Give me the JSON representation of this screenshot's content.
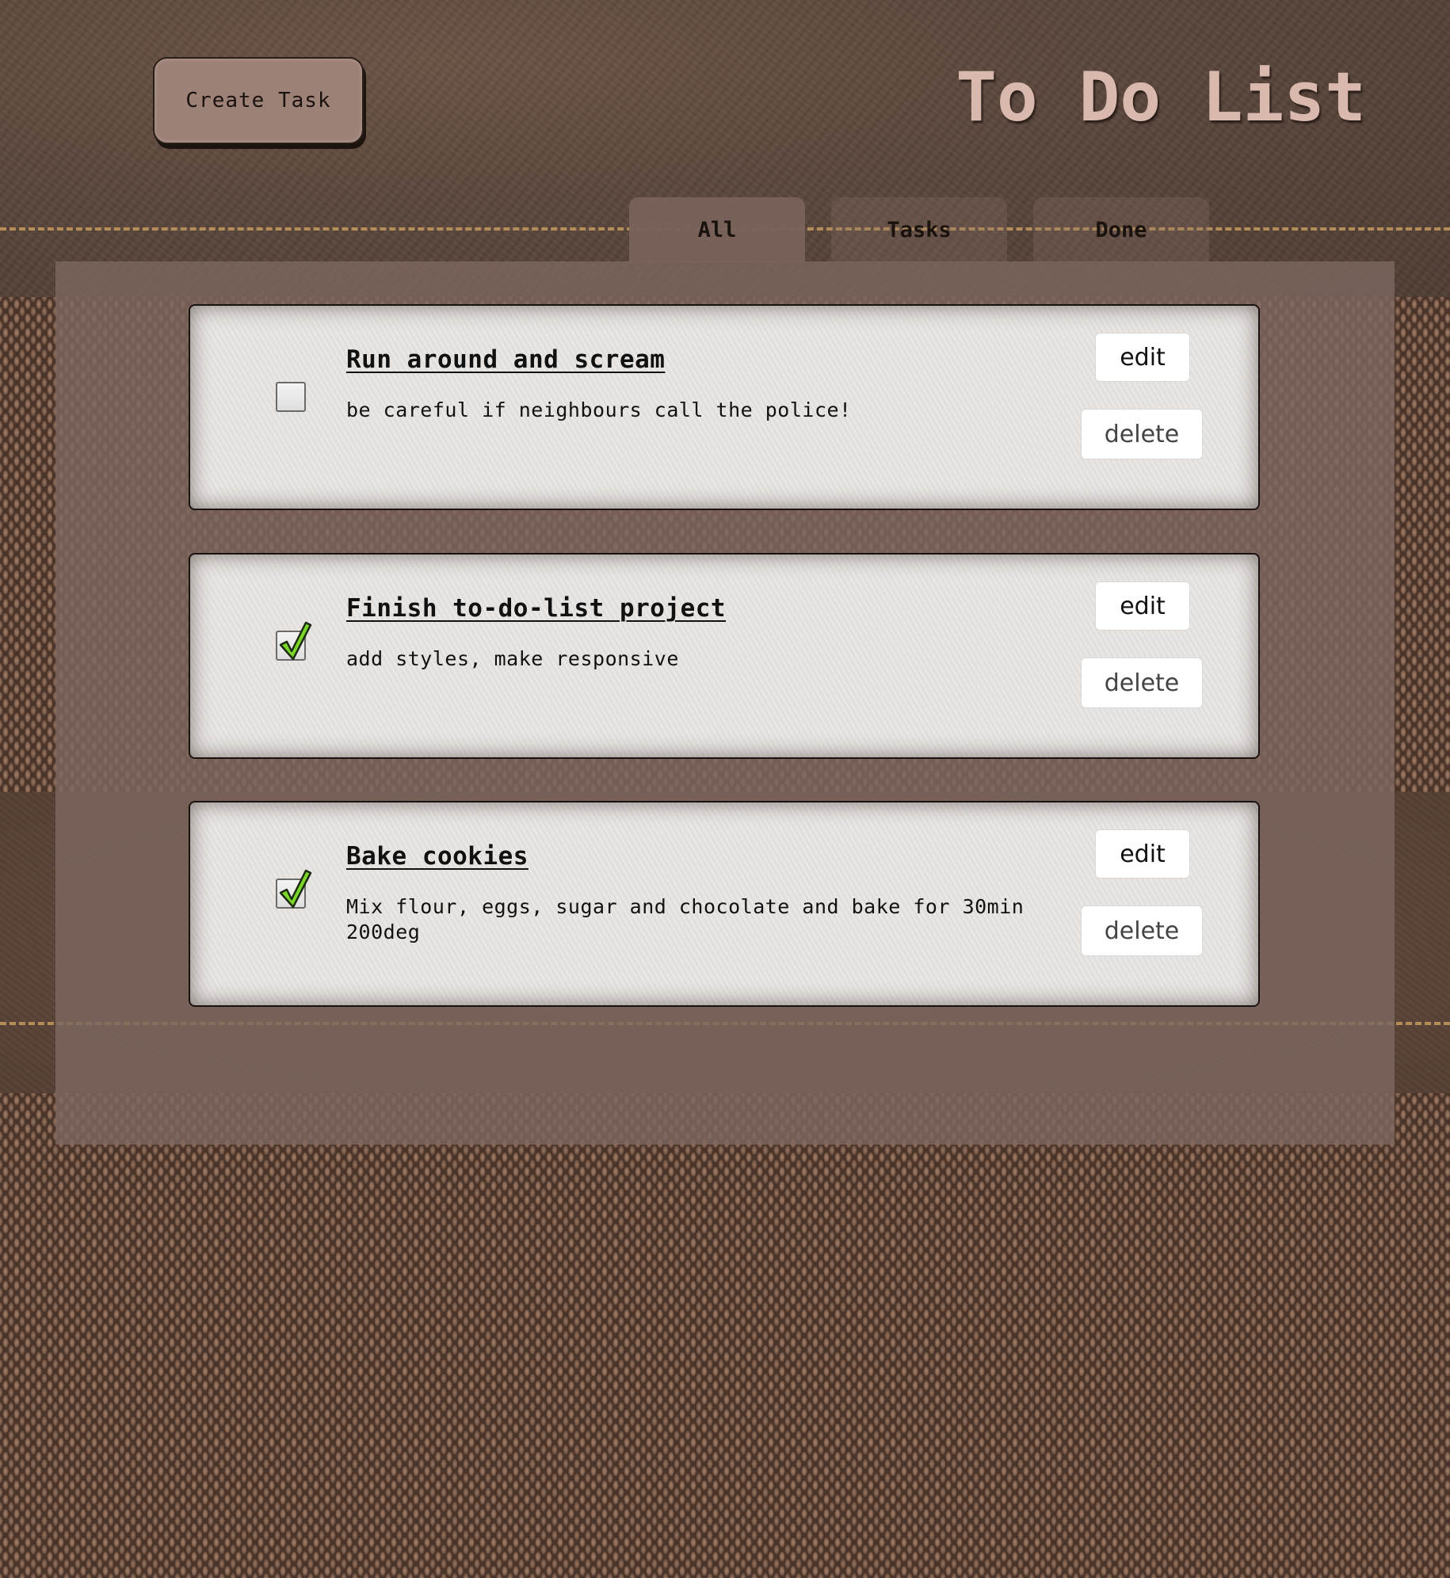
{
  "header": {
    "create_button_label": "Create Task",
    "title": "To Do List"
  },
  "tabs": [
    {
      "label": "All",
      "active": true
    },
    {
      "label": "Tasks",
      "active": false
    },
    {
      "label": "Done",
      "active": false
    }
  ],
  "tasks": [
    {
      "title": "Run around and scream",
      "description": "be careful if neighbours call the police!",
      "done": false,
      "edit_label": "edit",
      "delete_label": "delete"
    },
    {
      "title": "Finish to-do-list project",
      "description": "add styles, make responsive",
      "done": true,
      "edit_label": "edit",
      "delete_label": "delete"
    },
    {
      "title": "Bake cookies",
      "description": "Mix flour, eggs, sugar and chocolate and bake for 30min 200deg",
      "done": true,
      "edit_label": "edit",
      "delete_label": "delete"
    }
  ],
  "icons": {
    "checkmark": "checkmark-icon"
  },
  "colors": {
    "title": "#d9b8ae",
    "create_button": "#9c8176",
    "panel": "#7d675f",
    "card": "#e7e3e1",
    "stitch": "#c59a5e",
    "check": "#7bd62a"
  }
}
